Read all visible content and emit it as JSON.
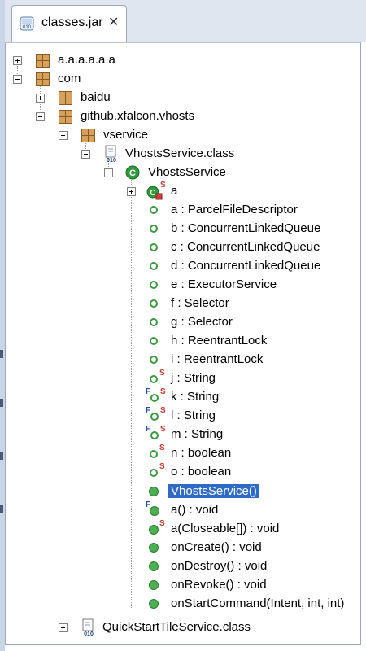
{
  "tab": {
    "title": "classes.jar",
    "icon": "jar-file-icon",
    "close": "close-icon"
  },
  "tree": {
    "pkg_a": "a.a.a.a.a.a",
    "pkg_com": "com",
    "pkg_baidu": "baidu",
    "pkg_github": "github.xfalcon.vhosts",
    "pkg_vservice": "vservice",
    "file_vhosts": "VhostsService.class",
    "class_vhosts": "VhostsService",
    "inner_a": "a",
    "members": [
      "a : ParcelFileDescriptor",
      "b : ConcurrentLinkedQueue",
      "c : ConcurrentLinkedQueue",
      "d : ConcurrentLinkedQueue",
      "e : ExecutorService",
      "f : Selector",
      "g : Selector",
      "h : ReentrantLock",
      "i : ReentrantLock",
      "j : String",
      "k : String",
      "l : String",
      "m : String",
      "n : boolean",
      "o : boolean",
      "VhostsService()",
      "a() : void",
      "a(Closeable[]) : void",
      "onCreate() : void",
      "onDestroy() : void",
      "onRevoke() : void",
      "onStartCommand(Intent, int, int)"
    ],
    "file_quickstart": "QuickStartTileService.class",
    "static_marker": "S",
    "final_marker": "F",
    "class_marker": "C",
    "class_file_marker": "010"
  },
  "colors": {
    "selection": "#2f6bc6",
    "field": "#3a9a3e",
    "package": "#d7a15c"
  }
}
